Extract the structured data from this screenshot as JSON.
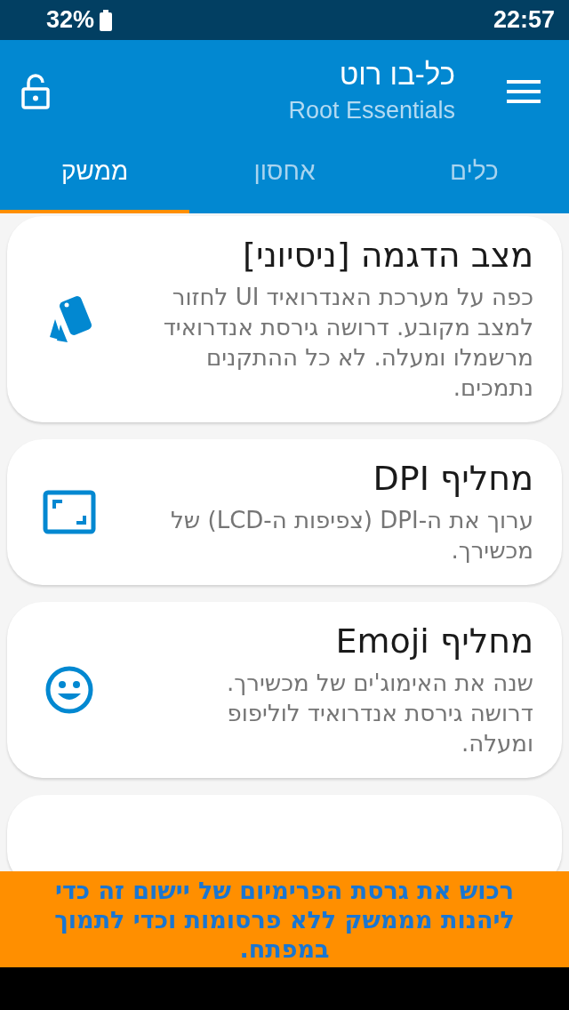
{
  "status_bar": {
    "battery": "32%",
    "time": "22:57"
  },
  "app_bar": {
    "title": "כל-בו רוט",
    "subtitle": "Root Essentials"
  },
  "tabs": [
    {
      "label": "כלים",
      "selected": false
    },
    {
      "label": "אחסון",
      "selected": false
    },
    {
      "label": "ממשק",
      "selected": true
    }
  ],
  "cards": [
    {
      "kind": "cards",
      "title": "מצב הדגמה [ניסיוני]",
      "description": "כפה על מערכת האנדרואיד UI לחזור למצב מקובע. דרושה גירסת אנדרואיד מרשמלו ומעלה. לא כל ההתקנים נתמכים."
    },
    {
      "kind": "screen",
      "title": "מחליף DPI",
      "description": "ערוך את ה-DPI (צפיפות ה-LCD) של מכשירך."
    },
    {
      "kind": "emoji",
      "title": "מחליף Emoji",
      "description": "שנה את האימוג'ים של מכשירך. דרושה גירסת אנדרואיד לוליפופ ומעלה."
    }
  ],
  "banner": {
    "text": "רכוש את גרסת הפרימיום של יישום זה כדי ליהנות מממשק ללא פרסומות וכדי לתמוך במפתח."
  }
}
